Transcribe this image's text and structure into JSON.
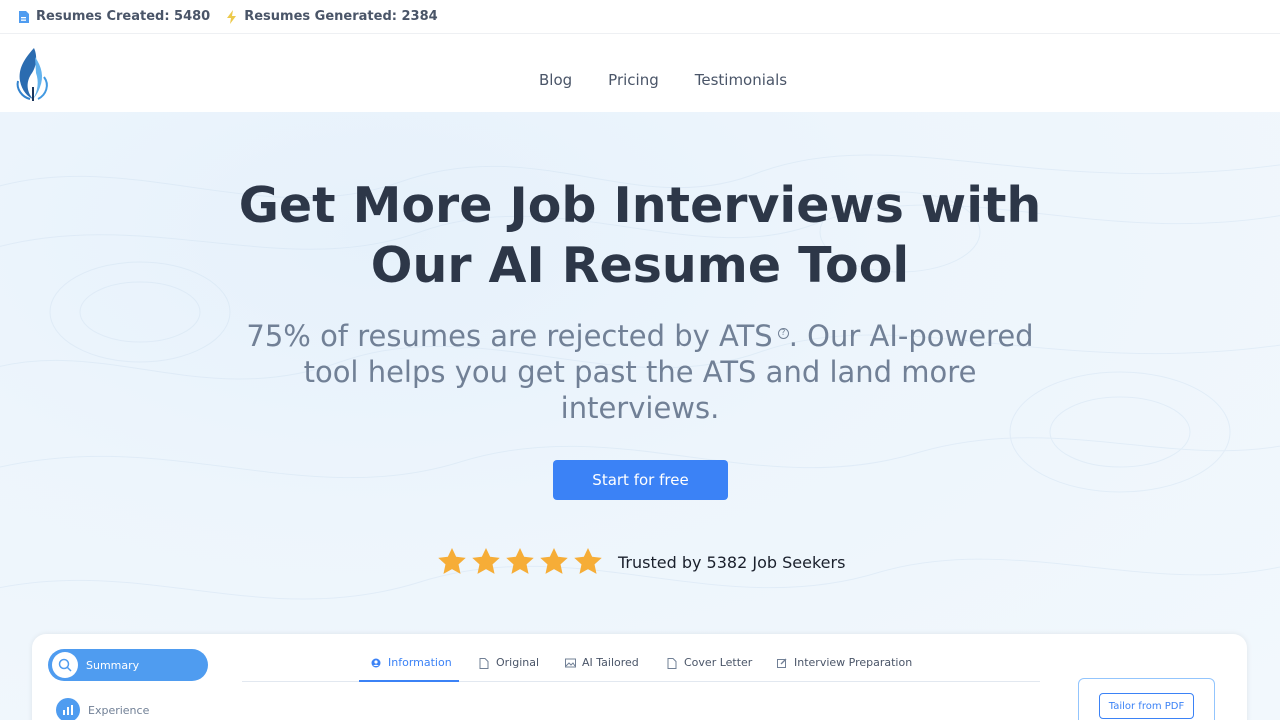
{
  "stats": {
    "resumes_created": "Resumes Created: 5480",
    "resumes_generated": "Resumes Generated: 2384"
  },
  "nav": [
    "Blog",
    "Pricing",
    "Testimonials"
  ],
  "hero": {
    "title_line1": "Get More Job Interviews with",
    "title_line2": "Our AI Resume Tool",
    "subtitle_a": "75% of resumes are rejected by ATS",
    "help_glyph": "?",
    "subtitle_b": ". Our AI-powered tool helps you get past the ATS and land more interviews.",
    "cta": "Start for free",
    "rating_stars": 5,
    "trusted": "Trusted by 5382 Job Seekers"
  },
  "preview": {
    "sidebar": [
      "Summary",
      "Experience"
    ],
    "tabs": [
      "Information",
      "Original",
      "AI Tailored",
      "Cover Letter",
      "Interview Preparation"
    ],
    "active_tab": "Information",
    "tailor_button": "Tailor from PDF"
  },
  "colors": {
    "accent": "#3b82f6",
    "star": "#f6ad37",
    "heading": "#2d3748",
    "muted": "#718096"
  }
}
